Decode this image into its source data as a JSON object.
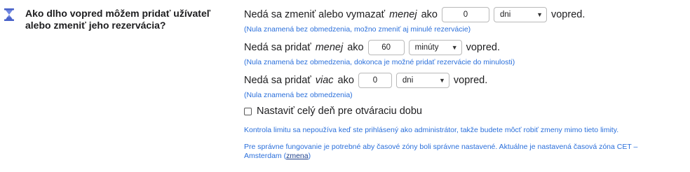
{
  "section": {
    "heading": "Ako dlho vopred môžem pridať užívateľ alebo zmeniť jeho rezervácia?"
  },
  "row1": {
    "text_before": "Nedá sa zmeniť alebo vymazať",
    "emphasis": "menej",
    "text_after_em": "ako",
    "value": "0",
    "unit": "dni",
    "text_end": "vopred.",
    "hint": "(Nula znamená bez obmedzenia, možno zmeniť aj minulé rezervácie)"
  },
  "row2": {
    "text_before": "Nedá sa pridať",
    "emphasis": "menej",
    "text_after_em": "ako",
    "value": "60",
    "unit": "minúty",
    "text_end": "vopred.",
    "hint": "(Nula znamená bez obmedzenia, dokonca je možné pridať rezervácie do minulosti)"
  },
  "row3": {
    "text_before": "Nedá sa pridať",
    "emphasis": "viac",
    "text_after_em": "ako",
    "value": "0",
    "unit": "dni",
    "text_end": "vopred.",
    "hint": "(Nula znamená bez obmedzenia)"
  },
  "checkbox": {
    "label": "Nastaviť celý deň pre otváraciu dobu",
    "checked": false
  },
  "notes": {
    "admin": "Kontrola limitu sa nepoužíva keď ste prihlásený ako administrátor, takže budete môcť robiť zmeny mimo tieto limity.",
    "timezone_text": "Pre správne fungovanie je potrebné aby časové zóny boli správne nastavené. Aktuálne je nastavená časová zóna CET – Amsterdam (",
    "timezone_link": "zmena",
    "timezone_end": ")"
  },
  "icons": {
    "hourglass": "hourglass-icon",
    "chevron": "chevron-down-icon"
  },
  "colors": {
    "hint_blue": "#2a6fdb",
    "hourglass": "#4a63c9"
  }
}
